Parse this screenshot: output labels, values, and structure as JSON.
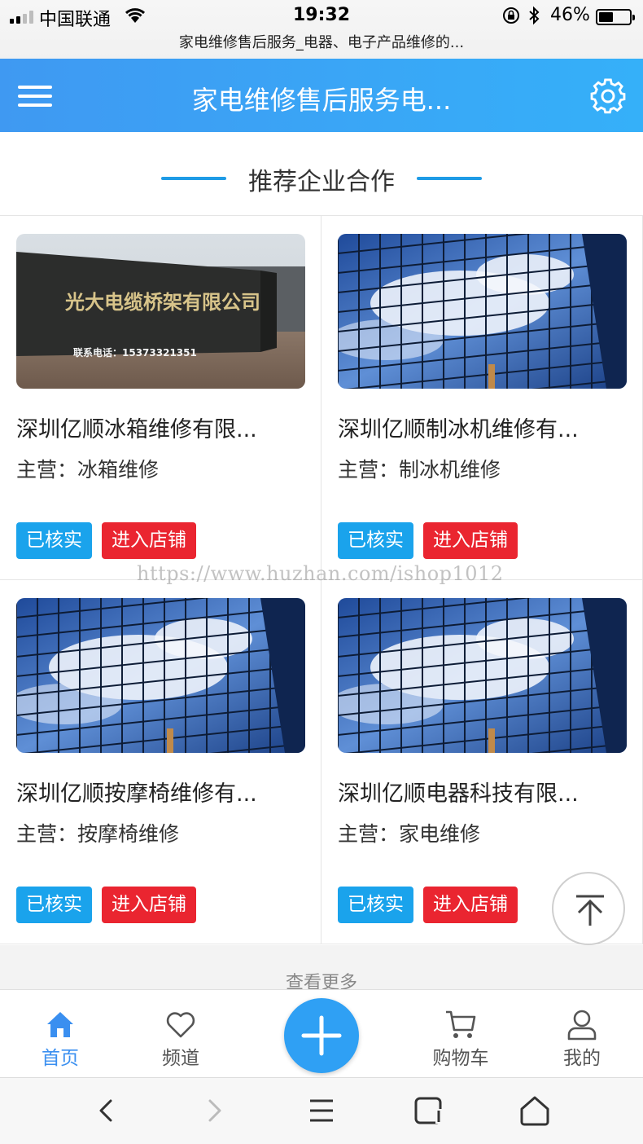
{
  "status_bar": {
    "carrier": "中国联通",
    "time": "19:32",
    "battery_percent": "46%",
    "battery_level": 0.46,
    "page_title": "家电维修售后服务_电器、电子产品维修的..."
  },
  "header": {
    "title": "家电维修售后服务电..."
  },
  "section": {
    "title": "推荐企业合作"
  },
  "companies": [
    {
      "name": "深圳亿顺冰箱维修有限...",
      "business": "主营：冰箱维修",
      "verified_label": "已核实",
      "enter_label": "进入店铺",
      "image_text": "光大电缆桥架有限公司",
      "image_phone": "联系电话：15373321351"
    },
    {
      "name": "深圳亿顺制冰机维修有...",
      "business": "主营：制冰机维修",
      "verified_label": "已核实",
      "enter_label": "进入店铺"
    },
    {
      "name": "深圳亿顺按摩椅维修有...",
      "business": "主营：按摩椅维修",
      "verified_label": "已核实",
      "enter_label": "进入店铺"
    },
    {
      "name": "深圳亿顺电器科技有限...",
      "business": "主营：家电维修",
      "verified_label": "已核实",
      "enter_label": "进入店铺"
    }
  ],
  "watermark": "https://www.huzhan.com/ishop1012",
  "more": "查看更多",
  "tabbar": {
    "items": [
      "首页",
      "频道",
      "购物车",
      "我的"
    ]
  },
  "colors": {
    "header_start": "#3f99f2",
    "header_end": "#35b0f9",
    "verified": "#1aa3ec",
    "enter": "#ea2530",
    "active_tab": "#3a8ff0",
    "fab": "#2fa0f4"
  }
}
